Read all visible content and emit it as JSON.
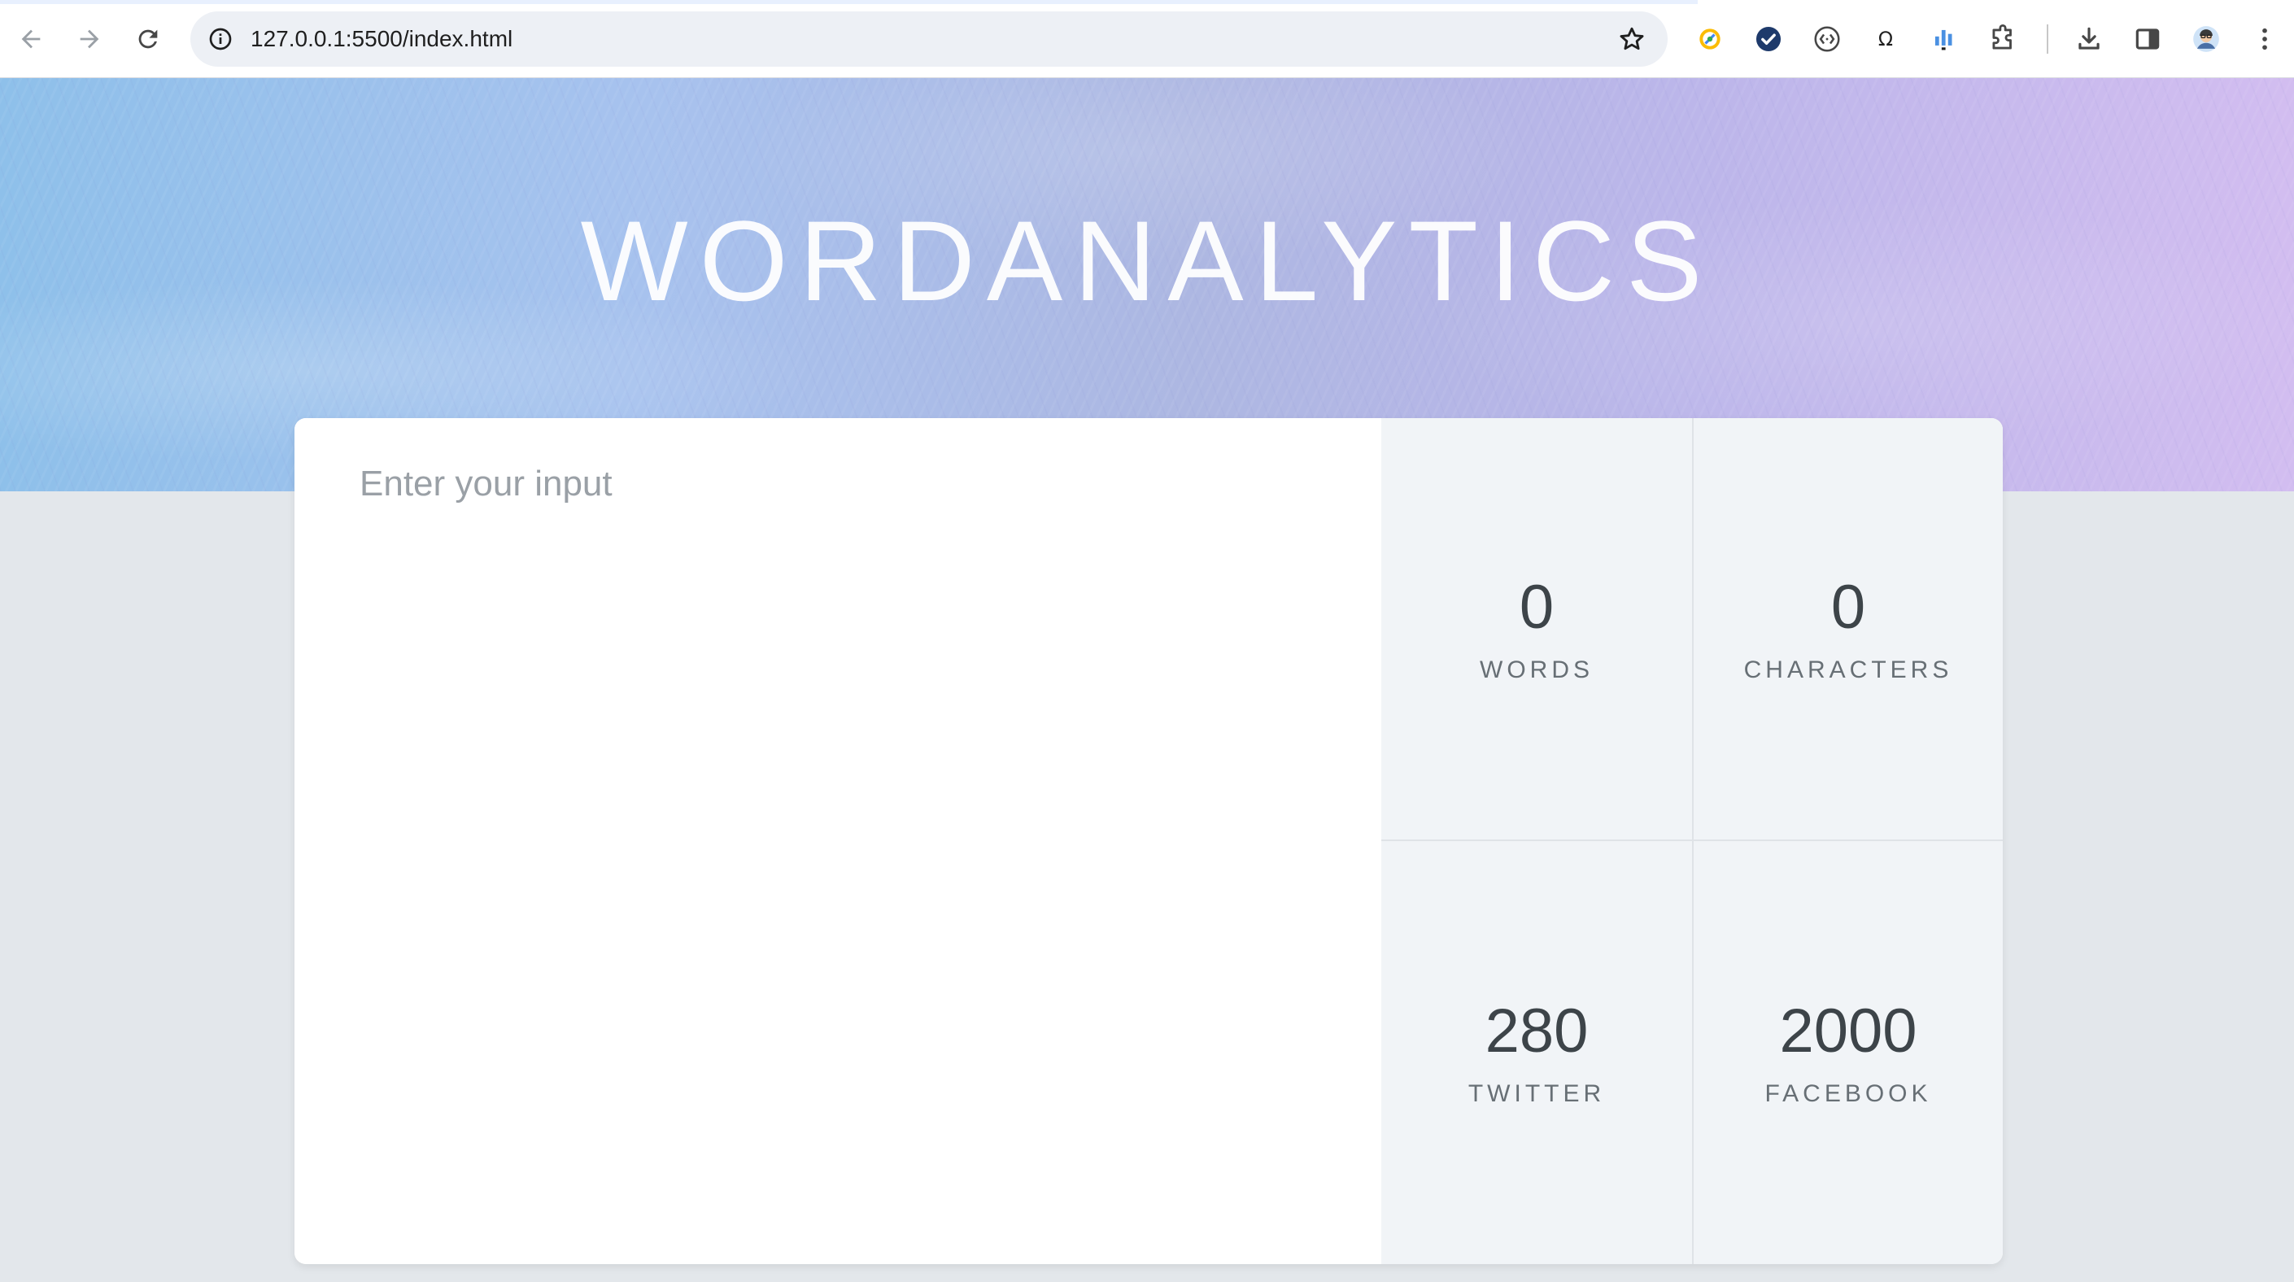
{
  "browser": {
    "url": "127.0.0.1:5500/index.html",
    "icons": {
      "back": "arrow-left-icon",
      "forward": "arrow-right-icon",
      "reload": "reload-icon",
      "site_info": "info-icon",
      "bookmark": "star-icon",
      "extensions": [
        "color-picker-extension-icon",
        "checkmark-extension-icon",
        "code-brackets-extension-icon",
        "omega-extension-icon",
        "chart-extension-icon",
        "puzzle-icon"
      ],
      "downloads": "download-icon",
      "side_panel": "side-panel-icon",
      "profile": "avatar",
      "menu": "kebab-menu-icon"
    }
  },
  "app": {
    "title": "WORDANALYTICS",
    "textarea": {
      "placeholder": "Enter your input",
      "value": ""
    },
    "stats": [
      {
        "number": "0",
        "label": "WORDS"
      },
      {
        "number": "0",
        "label": "CHARACTERS"
      },
      {
        "number": "280",
        "label": "TWITTER"
      },
      {
        "number": "2000",
        "label": "FACEBOOK"
      }
    ]
  },
  "colors": {
    "hero_start": "#8ec0ea",
    "hero_end": "#d2bdf0",
    "page_background": "#e3e7eb",
    "stats_background": "#f1f4f7",
    "stat_text": "#3d4449"
  }
}
